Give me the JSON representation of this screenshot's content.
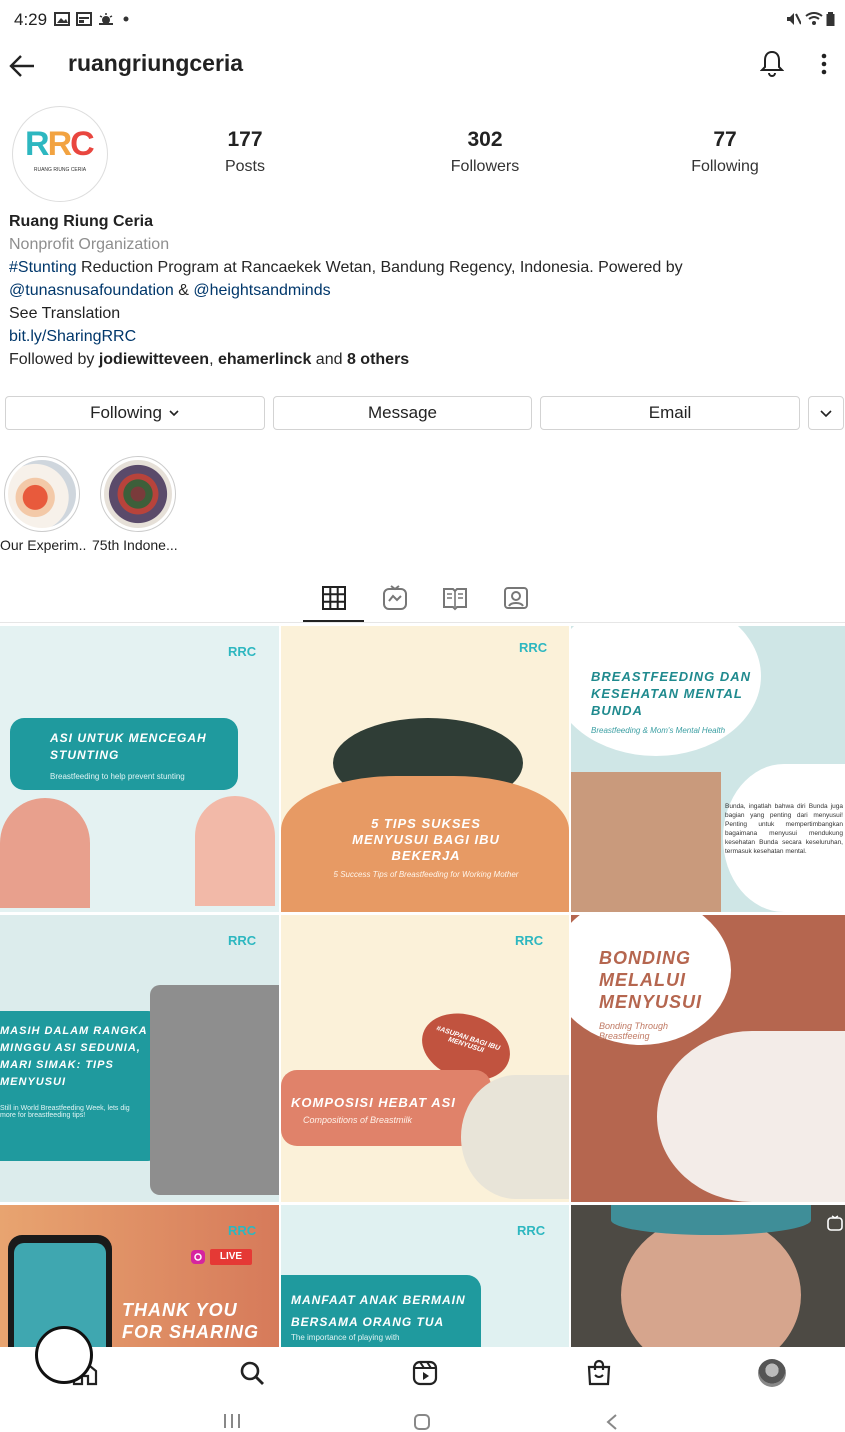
{
  "status_bar": {
    "time": "4:29"
  },
  "header": {
    "username": "ruangriungceria"
  },
  "profile": {
    "avatar_text": "RRC",
    "avatar_sub": "RUANG RIUNG CERIA",
    "posts": {
      "count": "177",
      "label": "Posts"
    },
    "followers": {
      "count": "302",
      "label": "Followers"
    },
    "following": {
      "count": "77",
      "label": "Following"
    }
  },
  "bio": {
    "name": "Ruang Riung Ceria",
    "category": "Nonprofit Organization",
    "hashtag": "#Stunting",
    "line1_rest": " Reduction Program at Rancaekek Wetan, Bandung Regency, Indonesia. Powered by",
    "mention1": "@tunasnusafoundation",
    "amp": " & ",
    "mention2": "@heightsandminds",
    "see_translation": "See Translation",
    "url": "bit.ly/SharingRRC",
    "followed_prefix": "Followed by ",
    "follower1": "jodiewitteveen",
    "comma": ", ",
    "follower2": "ehamerlinck",
    "and": " and ",
    "others": "8 others"
  },
  "buttons": {
    "following": "Following",
    "message": "Message",
    "email": "Email"
  },
  "highlights": [
    {
      "label": "Our Experim..."
    },
    {
      "label": "75th Indone..."
    }
  ],
  "posts": [
    {
      "title": "ASI UNTUK MENCEGAH STUNTING",
      "sub": "Breastfeeding to help prevent stunting"
    },
    {
      "title": "5 TIPS SUKSES MENYUSUI BAGI IBU BEKERJA",
      "sub": "5 Success Tips of Breastfeeding for Working Mother"
    },
    {
      "title": "BREASTFEEDING DAN KESEHATAN MENTAL BUNDA",
      "sub": "Breastfeeding & Mom's Mental Health"
    },
    {
      "title": "MASIH DALAM RANGKA MINGGU ASI SEDUNIA, MARI SIMAK: TIPS MENYUSUI",
      "sub": "Still in World Breastfeeding Week, lets dig more for breastfeeding tips!"
    },
    {
      "title": "KOMPOSISI HEBAT ASI",
      "sub": "Compositions of Breastmilk",
      "badge": "#ASUPAN BAGI IBU MENYUSUI"
    },
    {
      "title": "BONDING MELALUI MENYUSUI",
      "sub": "Bonding Through Breastfeeing"
    },
    {
      "title": "THANK YOU FOR SHARING",
      "badge": "LIVE"
    },
    {
      "title": "MANFAAT ANAK BERMAIN BERSAMA ORANG TUA",
      "sub": "The importance of playing with"
    },
    {
      "title": ""
    }
  ],
  "post3_body": "Bunda, ingatlah bahwa diri Bunda juga bagian yang penting dari menyusui! Penting untuk mempertimbangkan bagaimana menyusui mendukung kesehatan Bunda secara keseluruhan, termasuk kesehatan mental.",
  "logo_text": "RRC",
  "colors": {
    "teal": "#1f9a9e",
    "orange": "#e79a64",
    "rust": "#b5664f",
    "link": "#00376b"
  }
}
